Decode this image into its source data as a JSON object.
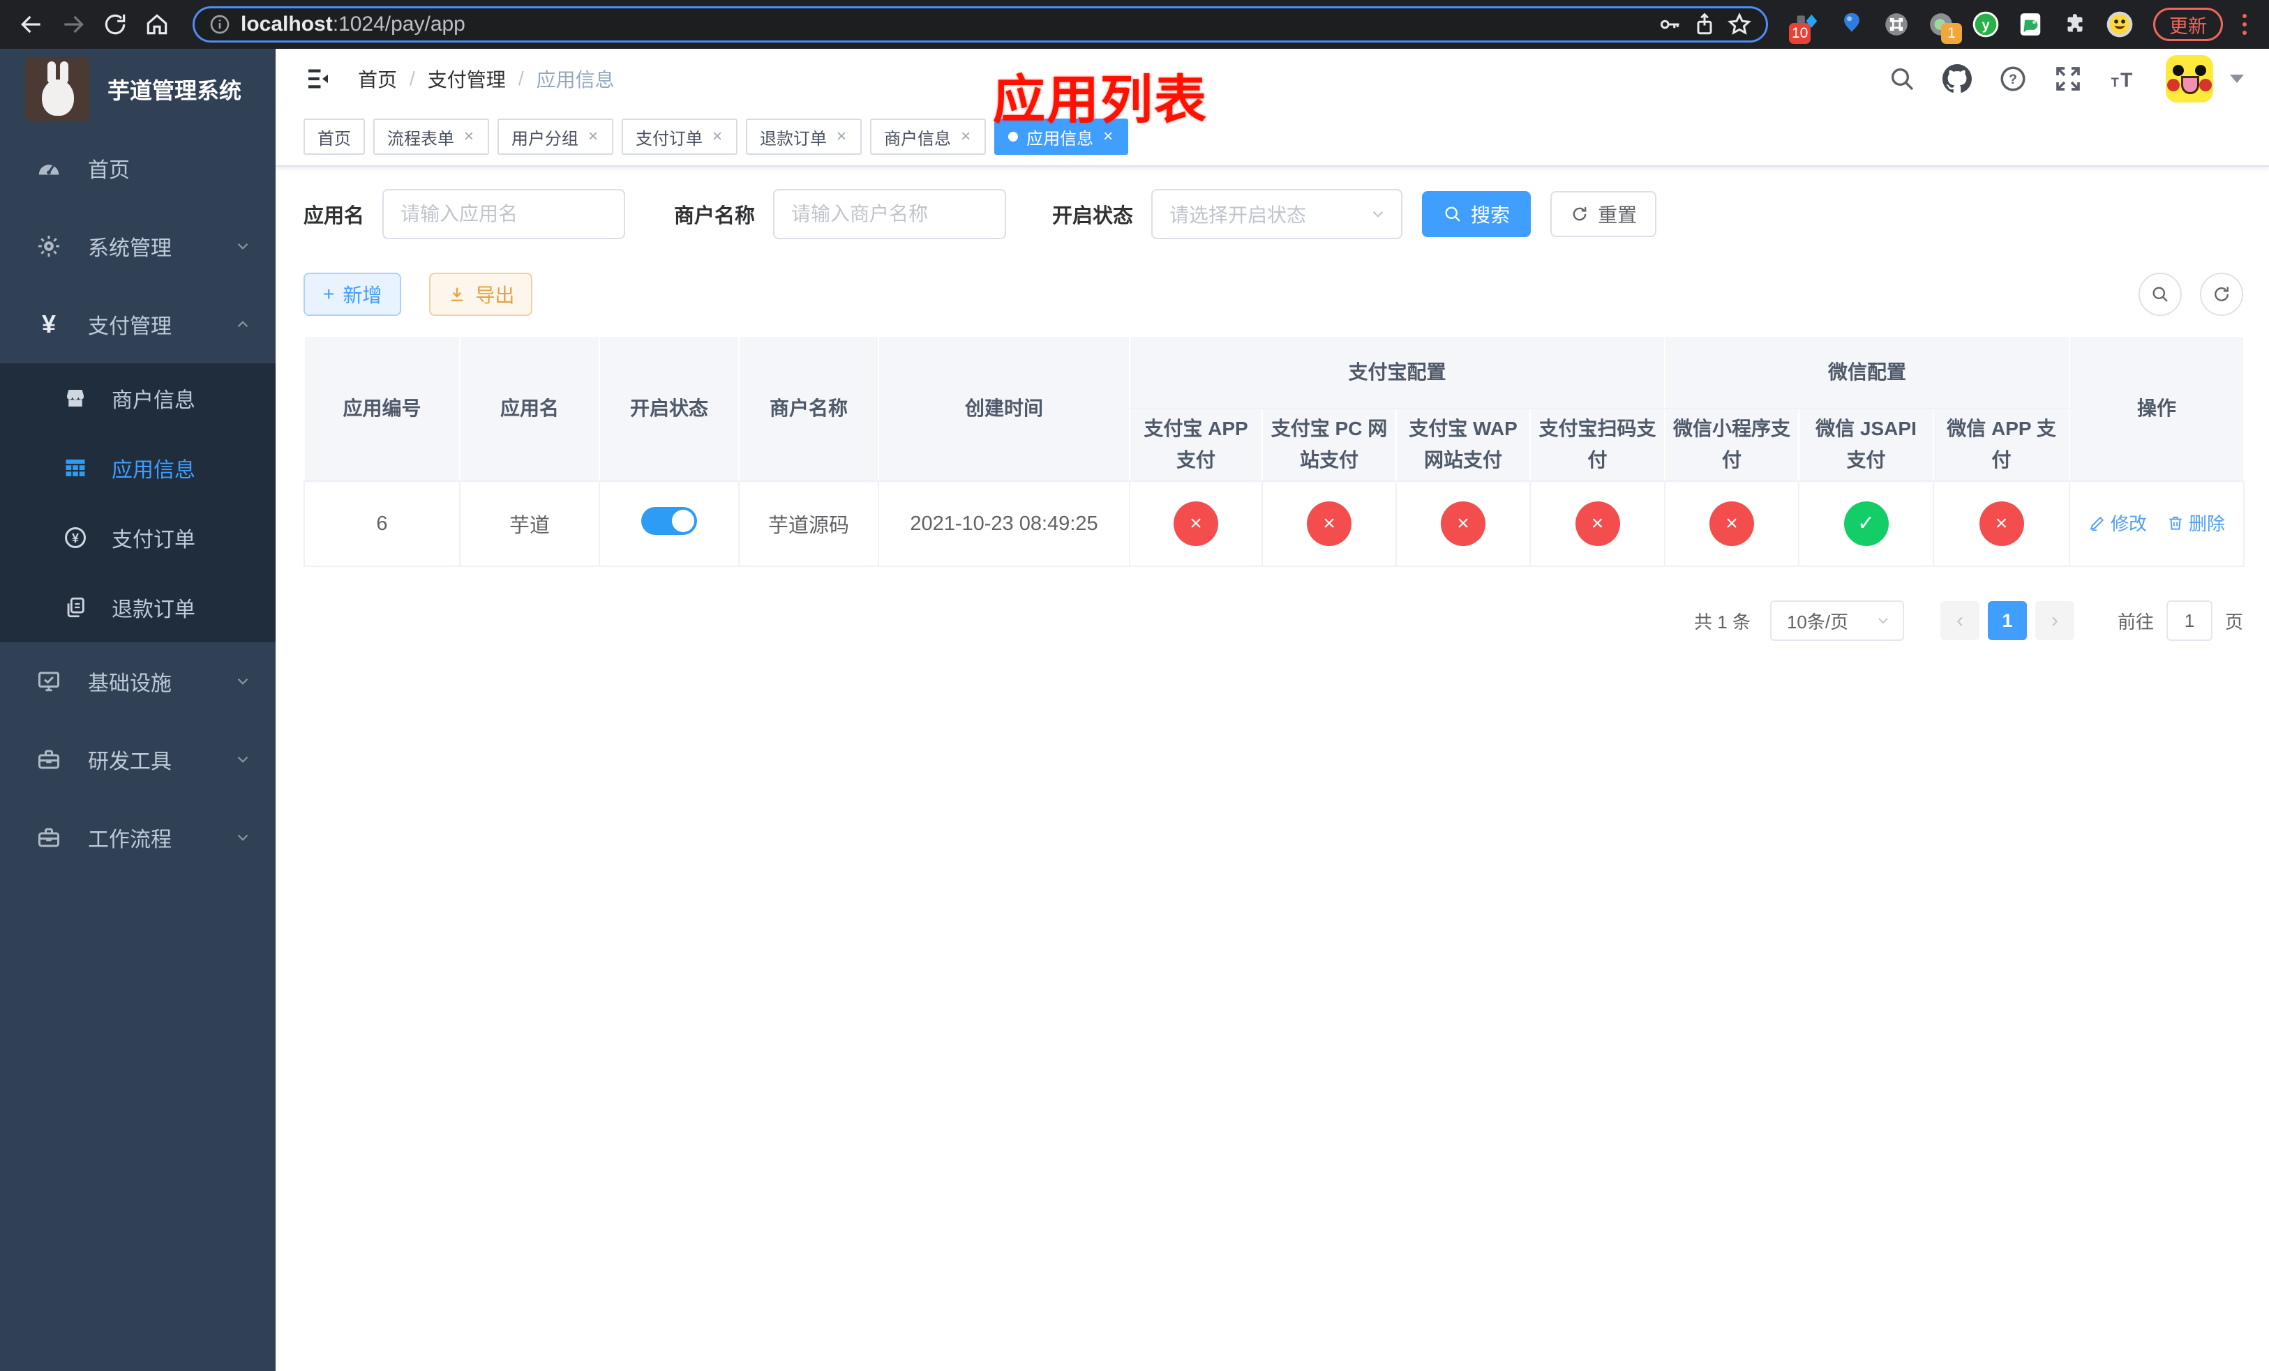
{
  "browser": {
    "url_host": "localhost",
    "url_rest": ":1024/pay/app",
    "update_label": "更新",
    "ext_badge_blue_diamond": "10",
    "ext_badge_proxy": "1"
  },
  "sidebar": {
    "title": "芋道管理系统",
    "items": [
      {
        "label": "首页"
      },
      {
        "label": "系统管理"
      },
      {
        "label": "支付管理"
      },
      {
        "label": "基础设施"
      },
      {
        "label": "研发工具"
      },
      {
        "label": "工作流程"
      }
    ],
    "submenu": [
      {
        "label": "商户信息"
      },
      {
        "label": "应用信息"
      },
      {
        "label": "支付订单"
      },
      {
        "label": "退款订单"
      }
    ]
  },
  "header": {
    "breadcrumb": [
      "首页",
      "支付管理",
      "应用信息"
    ],
    "annotation": "应用列表"
  },
  "tabs": [
    {
      "label": "首页"
    },
    {
      "label": "流程表单"
    },
    {
      "label": "用户分组"
    },
    {
      "label": "支付订单"
    },
    {
      "label": "退款订单"
    },
    {
      "label": "商户信息"
    },
    {
      "label": "应用信息"
    }
  ],
  "filters": {
    "app_name_label": "应用名",
    "app_name_placeholder": "请输入应用名",
    "merchant_label": "商户名称",
    "merchant_placeholder": "请输入商户名称",
    "status_label": "开启状态",
    "status_placeholder": "请选择开启状态",
    "search_label": "搜索",
    "reset_label": "重置"
  },
  "toolbar": {
    "add_label": "新增",
    "export_label": "导出"
  },
  "table": {
    "headers": {
      "app_id": "应用编号",
      "app_name": "应用名",
      "status": "开启状态",
      "merchant": "商户名称",
      "create_time": "创建时间",
      "alipay_group": "支付宝配置",
      "wechat_group": "微信配置",
      "alipay_cols": [
        "支付宝 APP 支付",
        "支付宝 PC 网站支付",
        "支付宝 WAP 网站支付",
        "支付宝扫码支付"
      ],
      "wechat_cols": [
        "微信小程序支付",
        "微信 JSAPI 支付",
        "微信 APP 支付"
      ],
      "actions": "操作"
    },
    "row": {
      "app_id": "6",
      "app_name": "芋道",
      "status_on": true,
      "merchant": "芋道源码",
      "create_time": "2021-10-23 08:49:25",
      "configs": [
        "off",
        "off",
        "off",
        "off",
        "off",
        "on",
        "off"
      ],
      "edit_label": "修改",
      "delete_label": "删除"
    }
  },
  "pagination": {
    "total": "共 1 条",
    "page_size": "10条/页",
    "current_page": "1",
    "goto_label": "前往",
    "goto_value": "1",
    "page_unit": "页"
  },
  "icons": {
    "close": "×",
    "plus": "+",
    "check": "✓",
    "cross": "×",
    "yen": "¥",
    "star": "☆",
    "prev": "‹",
    "next": "›"
  },
  "colors": {
    "primary": "#409eff",
    "success": "#13ce66",
    "danger": "#f34d4d",
    "warning": "#e6a23c",
    "sidebar_bg": "#304156",
    "submenu_bg": "#1f2d3d",
    "annotation_red": "#fe1100"
  }
}
